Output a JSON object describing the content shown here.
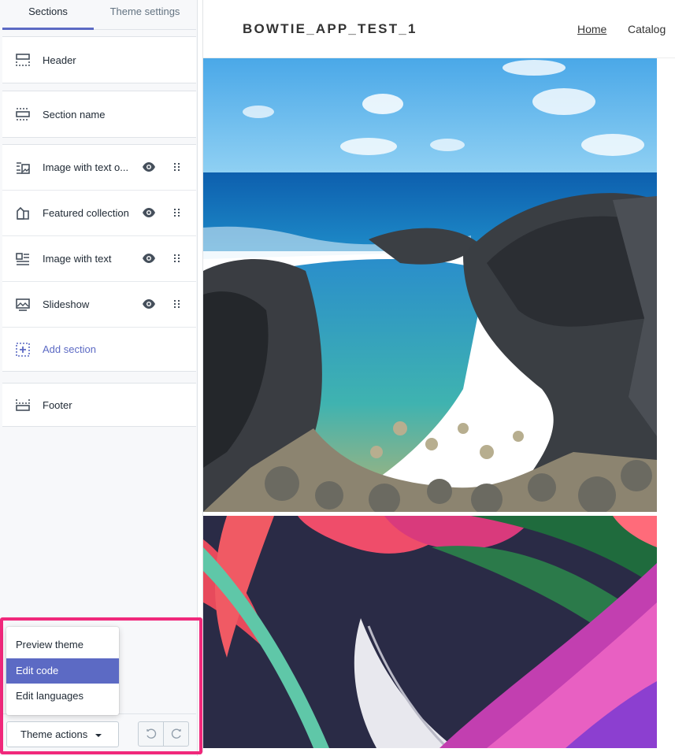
{
  "tabs": {
    "sections": "Sections",
    "theme_settings": "Theme settings"
  },
  "sections": {
    "header": {
      "label": "Header",
      "icon": "header-layout-icon"
    },
    "section_name": {
      "label": "Section name",
      "icon": "section-layout-icon"
    },
    "items": [
      {
        "label": "Image with text o...",
        "icon": "image-text-overlay-icon"
      },
      {
        "label": "Featured collection",
        "icon": "featured-collection-icon"
      },
      {
        "label": "Image with text",
        "icon": "image-with-text-icon"
      },
      {
        "label": "Slideshow",
        "icon": "slideshow-icon"
      }
    ],
    "add_section": "Add section",
    "footer": {
      "label": "Footer",
      "icon": "footer-layout-icon"
    }
  },
  "menu": {
    "items": [
      "Preview theme",
      "Edit code",
      "Edit languages"
    ],
    "selected": "Edit code"
  },
  "theme_actions": {
    "label": "Theme actions"
  },
  "preview": {
    "store_name": "BOWTIE_APP_TEST_1",
    "nav": [
      "Home",
      "Catalog"
    ]
  },
  "colors": {
    "accent": "#5c6ac4",
    "highlight": "#f0287b"
  }
}
